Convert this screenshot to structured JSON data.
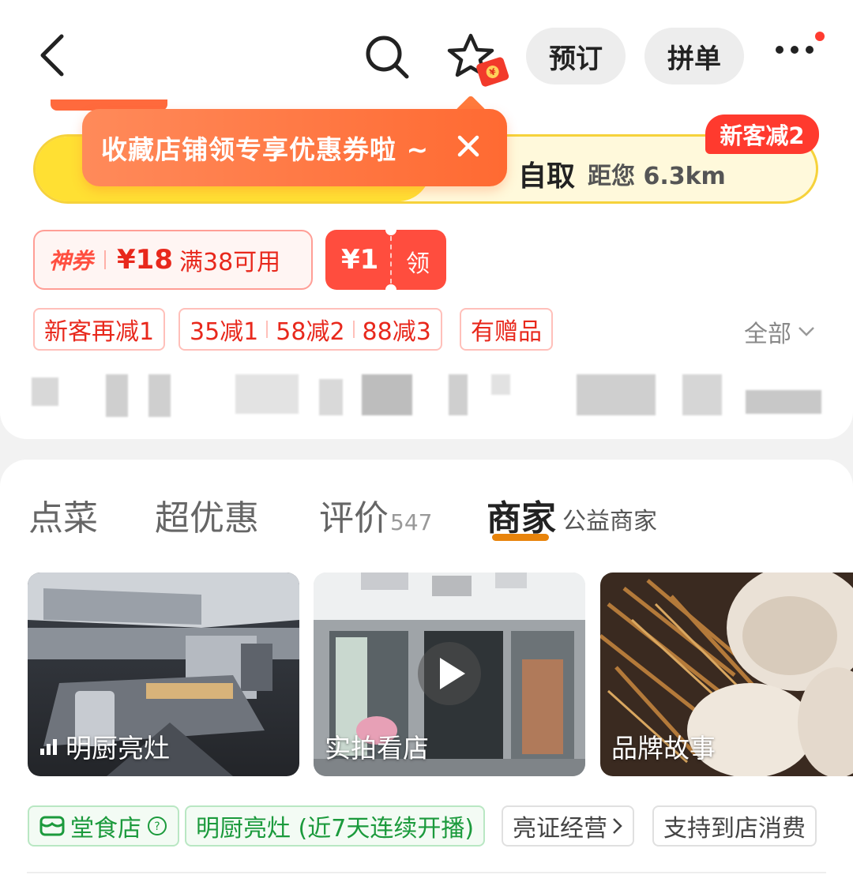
{
  "header": {
    "reserve_label": "预订",
    "group_order_label": "拼单",
    "icons": [
      "back-arrow-icon",
      "search-icon",
      "star-icon",
      "red-envelope-icon",
      "more-icon"
    ]
  },
  "tooltip": {
    "text": "收藏店铺领专享优惠券啦 ~",
    "close_icon": "close-icon"
  },
  "delivery_banner": {
    "mode": "自取",
    "distance": "距您 6.3km",
    "new_customer_badge": "新客减2"
  },
  "coupons": {
    "god_coupon_tag": "神券",
    "god_coupon_amount": "¥18",
    "god_coupon_condition": "满38可用",
    "small_coupon_amount": "¥1",
    "small_coupon_action": "领"
  },
  "promo_tags": {
    "new_customer": "新客再减1",
    "tier1": "35减1",
    "tier2": "58减2",
    "tier3": "88减3",
    "gift": "有赠品",
    "all_link": "全部"
  },
  "tabs": {
    "order": "点菜",
    "deals": "超优惠",
    "reviews": "评价",
    "reviews_count": "547",
    "merchant": "商家",
    "merchant_sub": "公益商家"
  },
  "tiles": {
    "kitchen": "明厨亮灶",
    "store": "实拍看店",
    "brand": "品牌故事"
  },
  "features": {
    "dine_in": "堂食店",
    "open_kitchen": "明厨亮灶 (近7天连续开播)",
    "license": "亮证经营",
    "in_store": "支持到店消费"
  },
  "colors": {
    "accent_red": "#ff4d3e",
    "tooltip_orange": "#ff7a3c",
    "banner_yellow": "#ffe033",
    "tab_underline": "#e8840c",
    "green": "#1b9a3c"
  }
}
